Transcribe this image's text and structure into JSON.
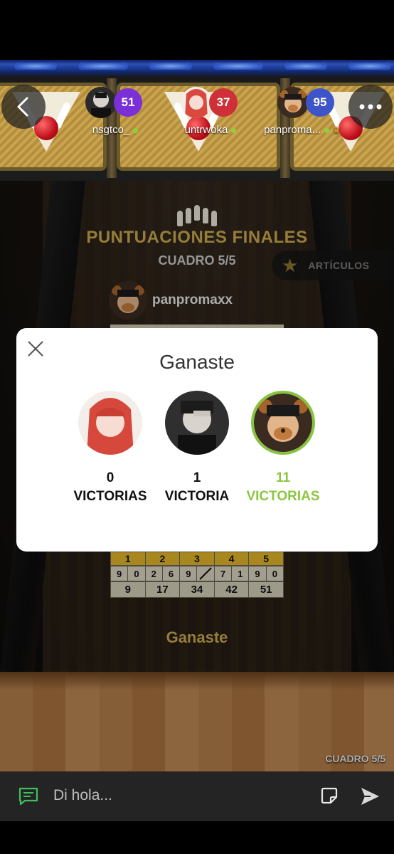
{
  "header": {
    "players": [
      {
        "name": "nsgtco_",
        "score": "51",
        "color": "#7b2fd6"
      },
      {
        "name": "untrwoka",
        "score": "37",
        "color": "#cf2f36"
      },
      {
        "name": "panproma...",
        "score": "95",
        "color": "#3e55c9"
      }
    ],
    "back_icon": "chevron-left-icon",
    "more_icon": "more-dots-icon"
  },
  "game": {
    "final_title": "PUNTUACIONES FINALES",
    "frame_label": "CUADRO 5/5",
    "articles_label": "ARTÍCULOS",
    "winner_name": "panpromaxx",
    "result_label": "Ganaste",
    "corner_frame": "CUADRO 5/5"
  },
  "scoresheet": {
    "frames": [
      "1",
      "2",
      "3",
      "4",
      "5"
    ],
    "rolls": [
      "9",
      "0",
      "2",
      "6",
      "9",
      "/",
      "7",
      "1",
      "9",
      "0"
    ],
    "totals": [
      "9",
      "17",
      "34",
      "42",
      "51"
    ]
  },
  "modal": {
    "title": "Ganaste",
    "results": [
      {
        "count": "0",
        "label": "VICTORIAS"
      },
      {
        "count": "1",
        "label": "VICTORIA"
      },
      {
        "count": "11",
        "label": "VICTORIAS"
      }
    ],
    "accent_color": "#8cc63f"
  },
  "chat": {
    "placeholder": "Di hola..."
  }
}
